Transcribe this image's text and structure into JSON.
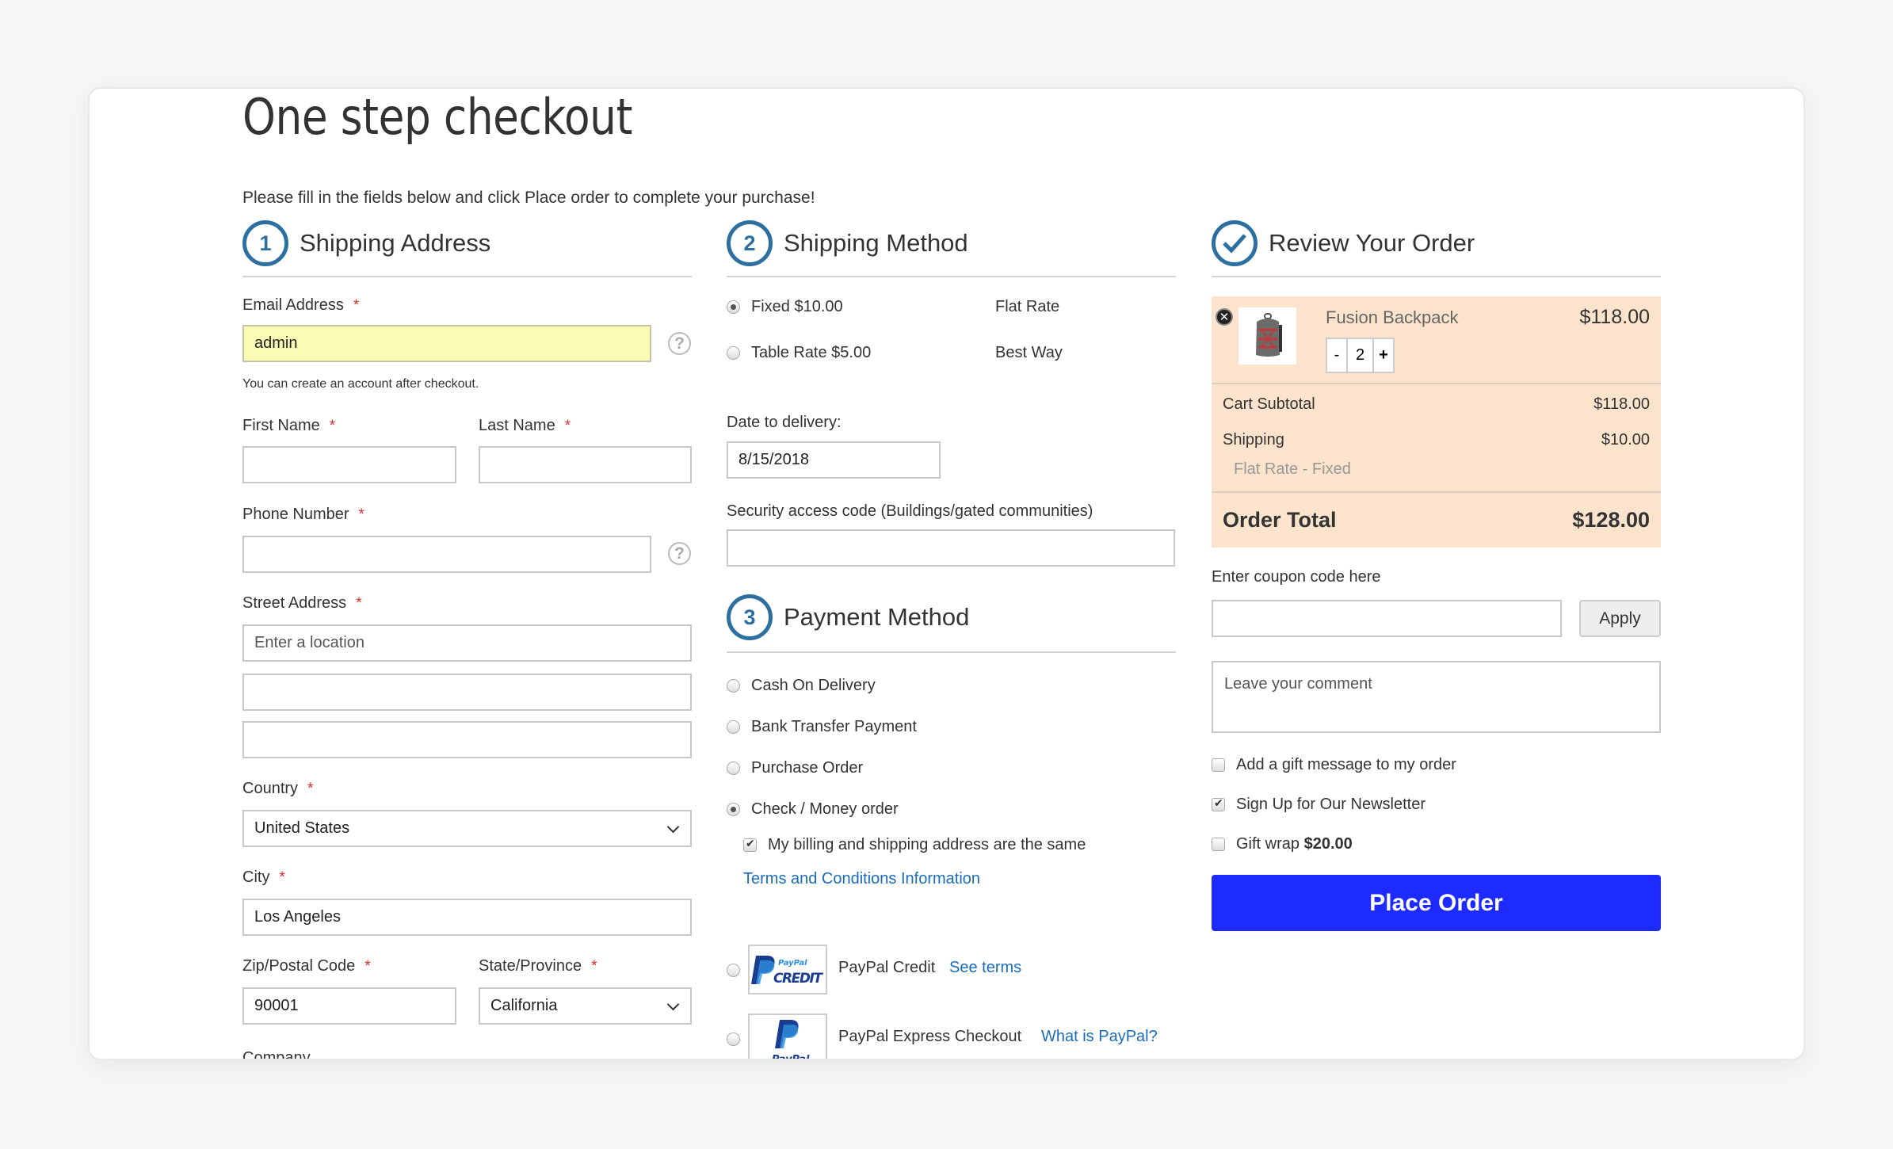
{
  "page": {
    "title": "One step checkout",
    "intro": "Please fill in the fields below and click Place order to complete your purchase!"
  },
  "colors": {
    "accent": "#2d6fa1",
    "place_order": "#1e2bff",
    "order_box": "#fbe3cc",
    "email_highlight": "#fafcb4",
    "required": "#e02b27",
    "link": "#1a6cb8"
  },
  "shipping_address": {
    "step": "1",
    "title": "Shipping Address",
    "required_mark": "*",
    "email": {
      "label": "Email Address",
      "value": "admin",
      "note": "You can create an account after checkout.",
      "help_icon": "?"
    },
    "first_name": {
      "label": "First Name",
      "value": ""
    },
    "last_name": {
      "label": "Last Name",
      "value": ""
    },
    "phone": {
      "label": "Phone Number",
      "value": "",
      "help_icon": "?"
    },
    "street": {
      "label": "Street Address",
      "placeholder": "Enter a location",
      "line2": "",
      "line3": ""
    },
    "country": {
      "label": "Country",
      "value": "United States"
    },
    "city": {
      "label": "City",
      "value": "Los Angeles"
    },
    "zip": {
      "label": "Zip/Postal Code",
      "value": "90001"
    },
    "state": {
      "label": "State/Province",
      "value": "California"
    },
    "company": {
      "label": "Company"
    }
  },
  "shipping_method": {
    "step": "2",
    "title": "Shipping Method",
    "options": [
      {
        "label": "Fixed $10.00",
        "carrier": "Flat Rate",
        "selected": true
      },
      {
        "label": "Table Rate $5.00",
        "carrier": "Best Way",
        "selected": false
      }
    ],
    "delivery_date": {
      "label": "Date to delivery:",
      "value": "8/15/2018"
    },
    "security_code": {
      "label": "Security access code (Buildings/gated communities)",
      "value": ""
    }
  },
  "payment_method": {
    "step": "3",
    "title": "Payment Method",
    "options": [
      {
        "label": "Cash On Delivery",
        "selected": false
      },
      {
        "label": "Bank Transfer Payment",
        "selected": false
      },
      {
        "label": "Purchase Order",
        "selected": false
      },
      {
        "label": "Check / Money order",
        "selected": true
      }
    ],
    "billing_same": {
      "label": "My billing and shipping address are the same",
      "checked": true
    },
    "terms_link": "Terms and Conditions Information",
    "paypal_credit": {
      "label": "PayPal Credit",
      "link": "See terms",
      "logo_top": "PayPal",
      "logo_bottom": "CREDIT"
    },
    "paypal_express": {
      "label": "PayPal Express Checkout",
      "link": "What is PayPal?",
      "logo_text": "PayPal"
    }
  },
  "review": {
    "title": "Review Your Order",
    "item": {
      "name": "Fusion Backpack",
      "price": "$118.00",
      "qty": "2",
      "minus": "-",
      "plus": "+"
    },
    "subtotal": {
      "label": "Cart Subtotal",
      "value": "$118.00"
    },
    "shipping": {
      "label": "Shipping",
      "value": "$10.00",
      "method": "Flat Rate - Fixed"
    },
    "total": {
      "label": "Order Total",
      "value": "$128.00"
    },
    "coupon": {
      "label": "Enter coupon code here",
      "value": "",
      "apply": "Apply"
    },
    "comment_placeholder": "Leave your comment",
    "gift_message": {
      "label": "Add a gift message to my order",
      "checked": false
    },
    "newsletter": {
      "label": "Sign Up for Our Newsletter",
      "checked": true
    },
    "gift_wrap": {
      "label": "Gift wrap",
      "price": "$20.00",
      "checked": false
    },
    "place_order": "Place Order"
  }
}
